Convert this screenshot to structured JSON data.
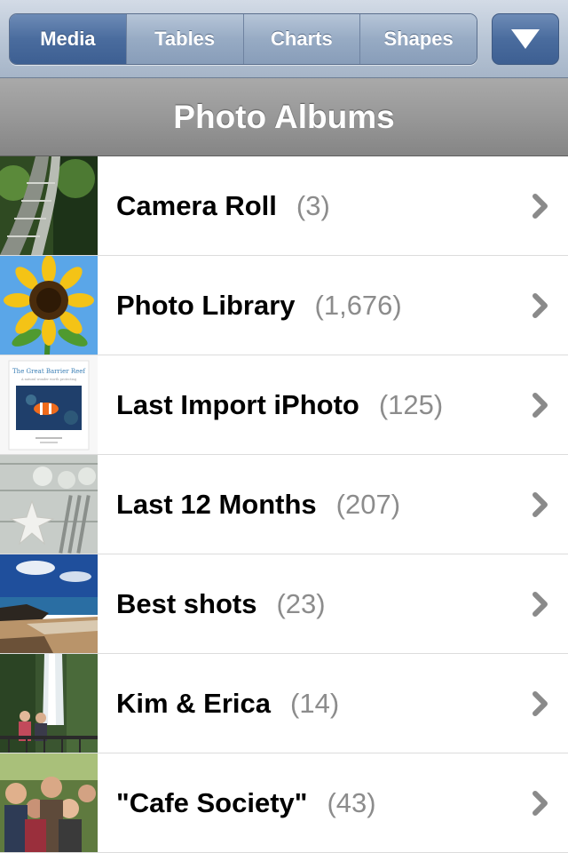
{
  "toolbar": {
    "tabs": [
      {
        "label": "Media",
        "selected": true
      },
      {
        "label": "Tables",
        "selected": false
      },
      {
        "label": "Charts",
        "selected": false
      },
      {
        "label": "Shapes",
        "selected": false
      }
    ],
    "dropdown_icon": "triangle-down-icon"
  },
  "header": {
    "title": "Photo Albums"
  },
  "albums": [
    {
      "name": "Camera Roll",
      "count": "(3)",
      "thumbnail": "roller-coaster-photo"
    },
    {
      "name": "Photo Library",
      "count": "(1,676)",
      "thumbnail": "sunflower-photo"
    },
    {
      "name": "Last Import iPhoto",
      "count": "(125)",
      "thumbnail": "great-barrier-reef-cover",
      "thumbnail_text": [
        "The Great Barrier Reef",
        "A natural wonder worth protecting"
      ]
    },
    {
      "name": "Last 12 Months",
      "count": "(207)",
      "thumbnail": "starfish-tableware-photo"
    },
    {
      "name": "Best shots",
      "count": "(23)",
      "thumbnail": "coastline-photo"
    },
    {
      "name": "Kim & Erica",
      "count": "(14)",
      "thumbnail": "waterfall-portrait-photo"
    },
    {
      "name": "\"Cafe Society\"",
      "count": "(43)",
      "thumbnail": "group-photo"
    }
  ],
  "colors": {
    "selected_segment": "#4a6c9e",
    "count_text": "#8c8c8c",
    "chevron": "#8a8a8a"
  }
}
